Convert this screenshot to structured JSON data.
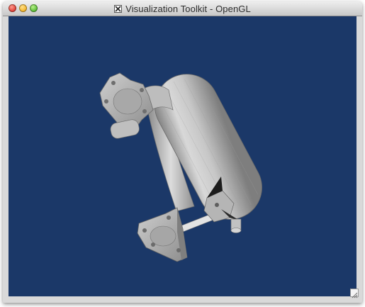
{
  "window": {
    "title": "Visualization Toolkit - OpenGL",
    "title_icon": "x11-icon"
  },
  "controls": {
    "close": "close-button",
    "minimize": "minimize-button",
    "zoom": "zoom-button"
  },
  "viewport": {
    "background_color": "#1b3868",
    "object_color": "#b9b9b9"
  }
}
